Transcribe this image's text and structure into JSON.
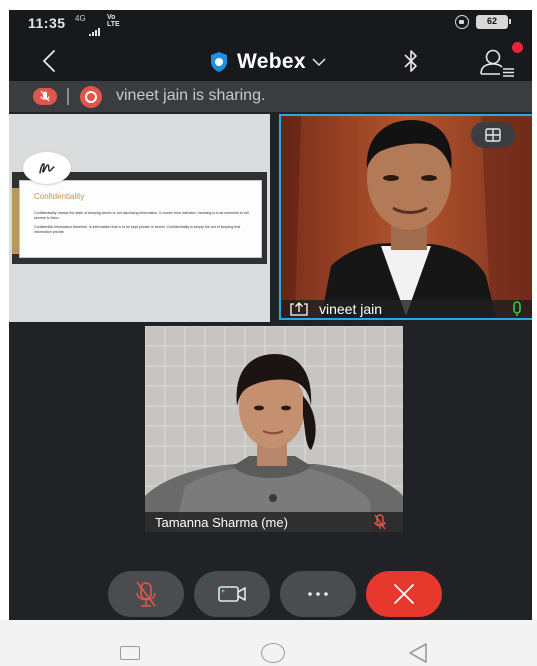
{
  "status_bar": {
    "time": "11:35",
    "network": "4G",
    "volte": "Vo\nLTE",
    "battery": "62"
  },
  "app_bar": {
    "title": "Webex",
    "icons": [
      "back-icon",
      "webex-shield-icon",
      "chevron-down-icon",
      "bluetooth-icon",
      "participants-icon"
    ]
  },
  "banner": {
    "text": "vineet jain is sharing."
  },
  "shared_slide": {
    "title": "Confidentiality",
    "paragraph_1": "Confidentiality means the state of keeping secret or not disclosing information. It comes from intention, meaning to trust someone to tell secrets to them.",
    "paragraph_2": "Confidential information therefore, is information that is to be kept private or secret. Confidentiality is simply the act of keeping that information private."
  },
  "speaker": {
    "name": "vineet jain"
  },
  "self_view": {
    "name": "Tamanna Sharma (me)"
  },
  "controls": {
    "mute": "mic-muted-icon",
    "video": "video-camera-icon",
    "more": "more-icon",
    "end": "close-icon"
  },
  "colors": {
    "accent_blue": "#28a9e0",
    "end_call_red": "#e6382c",
    "banner_red": "#e0574a",
    "mic_green": "#3ecf4a",
    "muted_red": "#e0574a"
  }
}
